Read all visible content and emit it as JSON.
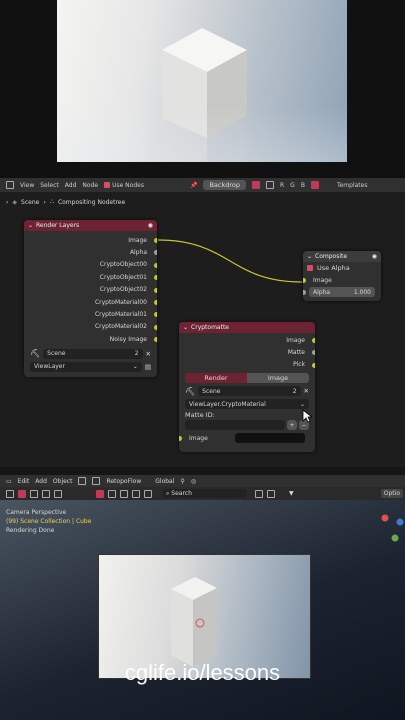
{
  "node_editor": {
    "header": {
      "menus": [
        "View",
        "Select",
        "Add",
        "Node"
      ],
      "use_nodes_label": "Use Nodes",
      "backdrop_label": "Backdrop",
      "channels": [
        "R",
        "G",
        "B"
      ],
      "templates_label": "Templates"
    },
    "breadcrumb": [
      "Scene",
      "Compositing Nodetree"
    ],
    "render_layers": {
      "title": "Render Layers",
      "outputs": [
        "Image",
        "Alpha",
        "CryptoObject00",
        "CryptoObject01",
        "CryptoObject02",
        "CryptoMaterial00",
        "CryptoMaterial01",
        "CryptoMaterial02",
        "Noisy Image"
      ],
      "scene_field": "Scene",
      "scene_users": "2",
      "view_layer": "ViewLayer"
    },
    "composite": {
      "title": "Composite",
      "use_alpha_label": "Use Alpha",
      "input_image": "Image",
      "alpha_label": "Alpha",
      "alpha_value": "1.000"
    },
    "cryptomatte": {
      "title": "Cryptomatte",
      "outputs": [
        "Image",
        "Matte",
        "Pick"
      ],
      "tabs": [
        "Render",
        "Image"
      ],
      "scene_field": "Scene",
      "scene_users": "2",
      "layer_field": "ViewLayer.CryptoMaterial",
      "matte_id_label": "Matte ID:",
      "input_image": "Image"
    }
  },
  "viewport": {
    "menus": [
      "Edit",
      "Add",
      "Object"
    ],
    "retopoflow_label": "RetopoFlow",
    "transform_label": "Global",
    "search_placeholder": "Search",
    "options_label": "Optio",
    "overlay_lines": [
      "Camera Perspective",
      "(99) Scene Collection | Cube",
      "Rendering Done"
    ]
  },
  "caption": "cglife.io/lessons"
}
